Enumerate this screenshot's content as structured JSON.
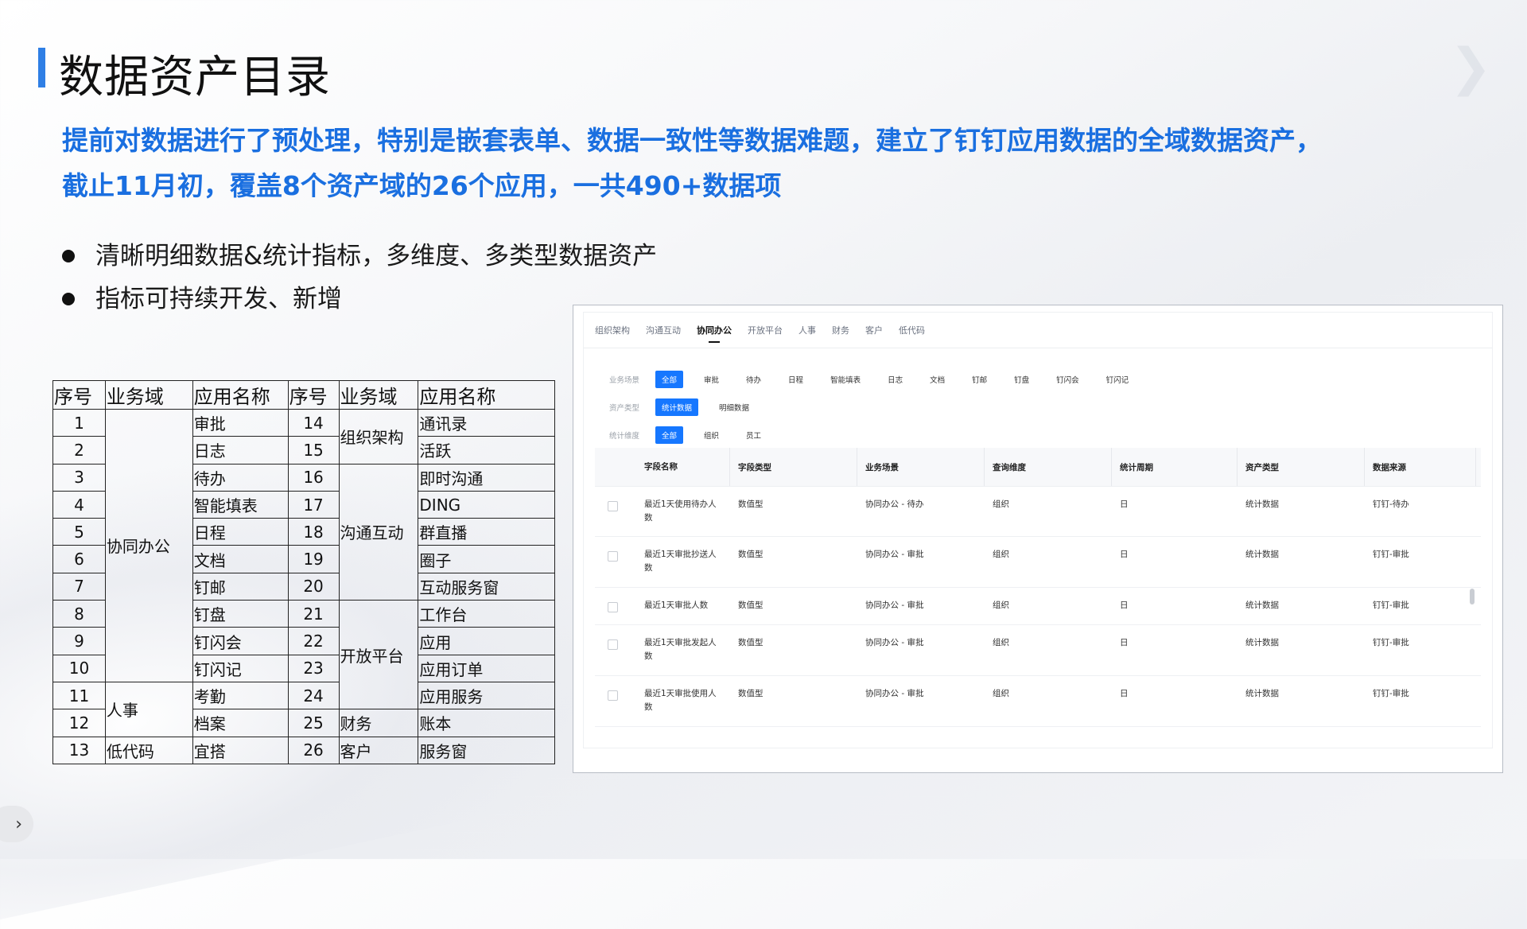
{
  "page": {
    "title": "数据资产目录",
    "highlight_line1": "提前对数据进行了预处理，特别是嵌套表单、数据一致性等数据难题，建立了钉钉应用数据的全域数据资产，",
    "highlight_line2": "截止11月初，覆盖8个资产域的26个应用，一共490+数据项",
    "bullets": [
      "清晰明细数据&统计指标，多维度、多类型数据资产",
      "指标可持续开发、新增"
    ],
    "accent_color": "#2f7fe5",
    "highlight_color": "#1a6fe0"
  },
  "table": {
    "headers": [
      "序号",
      "业务域",
      "应用名称",
      "序号",
      "业务域",
      "应用名称"
    ],
    "left_nums": [
      "1",
      "2",
      "3",
      "4",
      "5",
      "6",
      "7",
      "8",
      "9",
      "10",
      "11",
      "12",
      "13"
    ],
    "left_apps": [
      "审批",
      "日志",
      "待办",
      "智能填表",
      "日程",
      "文档",
      "钉邮",
      "钉盘",
      "钉闪会",
      "钉闪记",
      "考勤",
      "档案",
      "宜搭"
    ],
    "left_domains": [
      "协同办公",
      "人事",
      "低代码"
    ],
    "right_nums": [
      "14",
      "15",
      "16",
      "17",
      "18",
      "19",
      "20",
      "21",
      "22",
      "23",
      "24",
      "25",
      "26"
    ],
    "right_apps": [
      "通讯录",
      "活跃",
      "即时沟通",
      "DING",
      "群直播",
      "圈子",
      "互动服务窗",
      "工作台",
      "应用",
      "应用订单",
      "应用服务",
      "账本",
      "服务窗"
    ],
    "right_domains": [
      "组织架构",
      "沟通互动",
      "开放平台",
      "财务",
      "客户"
    ]
  },
  "panel": {
    "tabs": [
      "组织架构",
      "沟通互动",
      "协同办公",
      "开放平台",
      "人事",
      "财务",
      "客户",
      "低代码"
    ],
    "active_tab": "协同办公",
    "filters": [
      {
        "label": "业务场景",
        "options": [
          "全部",
          "审批",
          "待办",
          "日程",
          "智能填表",
          "日志",
          "文档",
          "钉邮",
          "钉盘",
          "钉闪会",
          "钉闪记"
        ],
        "selected": "全部"
      },
      {
        "label": "资产类型",
        "options": [
          "统计数据",
          "明细数据"
        ],
        "selected": "统计数据"
      },
      {
        "label": "统计维度",
        "options": [
          "全部",
          "组织",
          "员工"
        ],
        "selected": "全部"
      }
    ],
    "columns": [
      "字段名称",
      "字段类型",
      "业务场景",
      "查询维度",
      "统计周期",
      "资产类型",
      "数据来源"
    ],
    "rows": [
      [
        "最近1天使用待办人数",
        "数值型",
        "协同办公 - 待办",
        "组织",
        "日",
        "统计数据",
        "钉钉-待办"
      ],
      [
        "最近1天审批抄送人数",
        "数值型",
        "协同办公 - 审批",
        "组织",
        "日",
        "统计数据",
        "钉钉-审批"
      ],
      [
        "最近1天审批人数",
        "数值型",
        "协同办公 - 审批",
        "组织",
        "日",
        "统计数据",
        "钉钉-审批"
      ],
      [
        "最近1天审批发起人数",
        "数值型",
        "协同办公 - 审批",
        "组织",
        "日",
        "统计数据",
        "钉钉-审批"
      ],
      [
        "最近1天审批使用人数",
        "数值型",
        "协同办公 - 审批",
        "组织",
        "日",
        "统计数据",
        "钉钉-审批"
      ]
    ]
  },
  "nav": {
    "next_icon": "chevron-right-icon",
    "next_glyph": "›"
  }
}
